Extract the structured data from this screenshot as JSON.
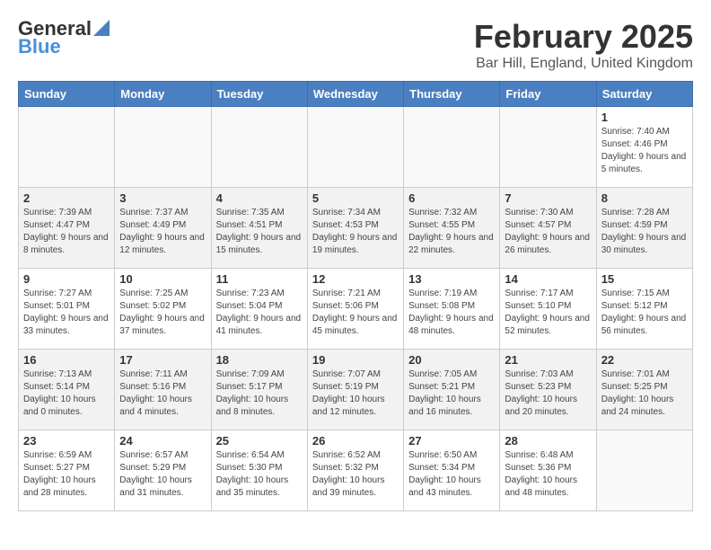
{
  "logo": {
    "text_general": "General",
    "text_blue": "Blue"
  },
  "header": {
    "title": "February 2025",
    "subtitle": "Bar Hill, England, United Kingdom"
  },
  "days_of_week": [
    "Sunday",
    "Monday",
    "Tuesday",
    "Wednesday",
    "Thursday",
    "Friday",
    "Saturday"
  ],
  "weeks": [
    {
      "shade": false,
      "days": [
        {
          "num": "",
          "info": ""
        },
        {
          "num": "",
          "info": ""
        },
        {
          "num": "",
          "info": ""
        },
        {
          "num": "",
          "info": ""
        },
        {
          "num": "",
          "info": ""
        },
        {
          "num": "",
          "info": ""
        },
        {
          "num": "1",
          "info": "Sunrise: 7:40 AM\nSunset: 4:46 PM\nDaylight: 9 hours and 5 minutes."
        }
      ]
    },
    {
      "shade": true,
      "days": [
        {
          "num": "2",
          "info": "Sunrise: 7:39 AM\nSunset: 4:47 PM\nDaylight: 9 hours and 8 minutes."
        },
        {
          "num": "3",
          "info": "Sunrise: 7:37 AM\nSunset: 4:49 PM\nDaylight: 9 hours and 12 minutes."
        },
        {
          "num": "4",
          "info": "Sunrise: 7:35 AM\nSunset: 4:51 PM\nDaylight: 9 hours and 15 minutes."
        },
        {
          "num": "5",
          "info": "Sunrise: 7:34 AM\nSunset: 4:53 PM\nDaylight: 9 hours and 19 minutes."
        },
        {
          "num": "6",
          "info": "Sunrise: 7:32 AM\nSunset: 4:55 PM\nDaylight: 9 hours and 22 minutes."
        },
        {
          "num": "7",
          "info": "Sunrise: 7:30 AM\nSunset: 4:57 PM\nDaylight: 9 hours and 26 minutes."
        },
        {
          "num": "8",
          "info": "Sunrise: 7:28 AM\nSunset: 4:59 PM\nDaylight: 9 hours and 30 minutes."
        }
      ]
    },
    {
      "shade": false,
      "days": [
        {
          "num": "9",
          "info": "Sunrise: 7:27 AM\nSunset: 5:01 PM\nDaylight: 9 hours and 33 minutes."
        },
        {
          "num": "10",
          "info": "Sunrise: 7:25 AM\nSunset: 5:02 PM\nDaylight: 9 hours and 37 minutes."
        },
        {
          "num": "11",
          "info": "Sunrise: 7:23 AM\nSunset: 5:04 PM\nDaylight: 9 hours and 41 minutes."
        },
        {
          "num": "12",
          "info": "Sunrise: 7:21 AM\nSunset: 5:06 PM\nDaylight: 9 hours and 45 minutes."
        },
        {
          "num": "13",
          "info": "Sunrise: 7:19 AM\nSunset: 5:08 PM\nDaylight: 9 hours and 48 minutes."
        },
        {
          "num": "14",
          "info": "Sunrise: 7:17 AM\nSunset: 5:10 PM\nDaylight: 9 hours and 52 minutes."
        },
        {
          "num": "15",
          "info": "Sunrise: 7:15 AM\nSunset: 5:12 PM\nDaylight: 9 hours and 56 minutes."
        }
      ]
    },
    {
      "shade": true,
      "days": [
        {
          "num": "16",
          "info": "Sunrise: 7:13 AM\nSunset: 5:14 PM\nDaylight: 10 hours and 0 minutes."
        },
        {
          "num": "17",
          "info": "Sunrise: 7:11 AM\nSunset: 5:16 PM\nDaylight: 10 hours and 4 minutes."
        },
        {
          "num": "18",
          "info": "Sunrise: 7:09 AM\nSunset: 5:17 PM\nDaylight: 10 hours and 8 minutes."
        },
        {
          "num": "19",
          "info": "Sunrise: 7:07 AM\nSunset: 5:19 PM\nDaylight: 10 hours and 12 minutes."
        },
        {
          "num": "20",
          "info": "Sunrise: 7:05 AM\nSunset: 5:21 PM\nDaylight: 10 hours and 16 minutes."
        },
        {
          "num": "21",
          "info": "Sunrise: 7:03 AM\nSunset: 5:23 PM\nDaylight: 10 hours and 20 minutes."
        },
        {
          "num": "22",
          "info": "Sunrise: 7:01 AM\nSunset: 5:25 PM\nDaylight: 10 hours and 24 minutes."
        }
      ]
    },
    {
      "shade": false,
      "days": [
        {
          "num": "23",
          "info": "Sunrise: 6:59 AM\nSunset: 5:27 PM\nDaylight: 10 hours and 28 minutes."
        },
        {
          "num": "24",
          "info": "Sunrise: 6:57 AM\nSunset: 5:29 PM\nDaylight: 10 hours and 31 minutes."
        },
        {
          "num": "25",
          "info": "Sunrise: 6:54 AM\nSunset: 5:30 PM\nDaylight: 10 hours and 35 minutes."
        },
        {
          "num": "26",
          "info": "Sunrise: 6:52 AM\nSunset: 5:32 PM\nDaylight: 10 hours and 39 minutes."
        },
        {
          "num": "27",
          "info": "Sunrise: 6:50 AM\nSunset: 5:34 PM\nDaylight: 10 hours and 43 minutes."
        },
        {
          "num": "28",
          "info": "Sunrise: 6:48 AM\nSunset: 5:36 PM\nDaylight: 10 hours and 48 minutes."
        },
        {
          "num": "",
          "info": ""
        }
      ]
    }
  ]
}
